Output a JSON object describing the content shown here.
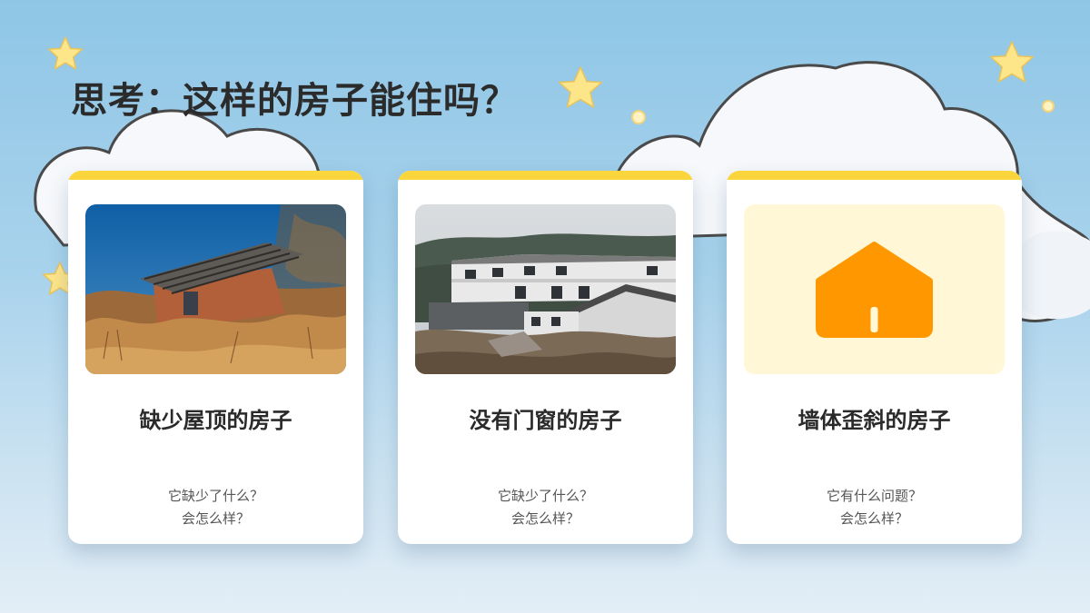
{
  "title": "思考：这样的房子能住吗？",
  "colors": {
    "accent_bar": "#fbd53c",
    "house_icon": "#ff9800",
    "icon_panel": "#fff7d6",
    "star": "#fde58a"
  },
  "cards": [
    {
      "title": "缺少屋顶的房子",
      "image": "ruined-house-without-roof-photo",
      "questions": [
        "它缺少了什么？",
        "会怎么样？"
      ]
    },
    {
      "title": "没有门窗的房子",
      "image": "unfinished-buildings-without-windows-photo",
      "questions": [
        "它缺少了什么？",
        "会怎么样？"
      ]
    },
    {
      "title": "墙体歪斜的房子",
      "image": "house-icon",
      "questions": [
        "它有什么问题？",
        "会怎么样？"
      ]
    }
  ]
}
